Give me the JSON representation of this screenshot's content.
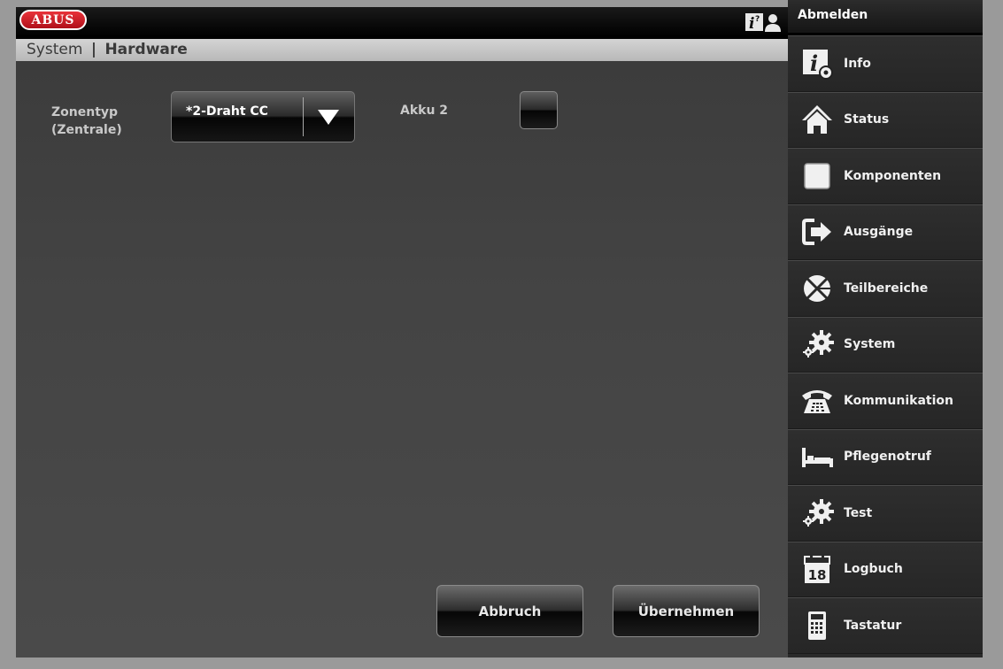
{
  "header": {
    "logo_text": "ABUS",
    "logout_label": "Abmelden"
  },
  "breadcrumb": {
    "parent": "System",
    "separator": "|",
    "current": "Hardware"
  },
  "form": {
    "zone_type_label_line1": "Zonentyp",
    "zone_type_label_line2": "(Zentrale)",
    "zone_type_value": "*2-Draht CC",
    "akku_label": "Akku 2",
    "akku_checked": false
  },
  "buttons": {
    "cancel_label": "Abbruch",
    "apply_label": "Übernehmen"
  },
  "sidebar": {
    "items": [
      {
        "label": "Info",
        "icon": "info-settings-icon"
      },
      {
        "label": "Status",
        "icon": "home-icon"
      },
      {
        "label": "Komponenten",
        "icon": "square-icon"
      },
      {
        "label": "Ausgänge",
        "icon": "exit-arrow-icon"
      },
      {
        "label": "Teilbereiche",
        "icon": "partition-icon"
      },
      {
        "label": "System",
        "icon": "gears-icon"
      },
      {
        "label": "Kommunikation",
        "icon": "telephone-icon"
      },
      {
        "label": "Pflegenotruf",
        "icon": "bed-icon"
      },
      {
        "label": "Test",
        "icon": "gears-icon"
      },
      {
        "label": "Logbuch",
        "icon": "calendar-icon"
      },
      {
        "label": "Tastatur",
        "icon": "keypad-icon"
      }
    ],
    "calendar_day": "18"
  },
  "colors": {
    "brand_red": "#c8141e",
    "sidebar_bg": "#2a2a2a",
    "content_bg": "#444444"
  }
}
